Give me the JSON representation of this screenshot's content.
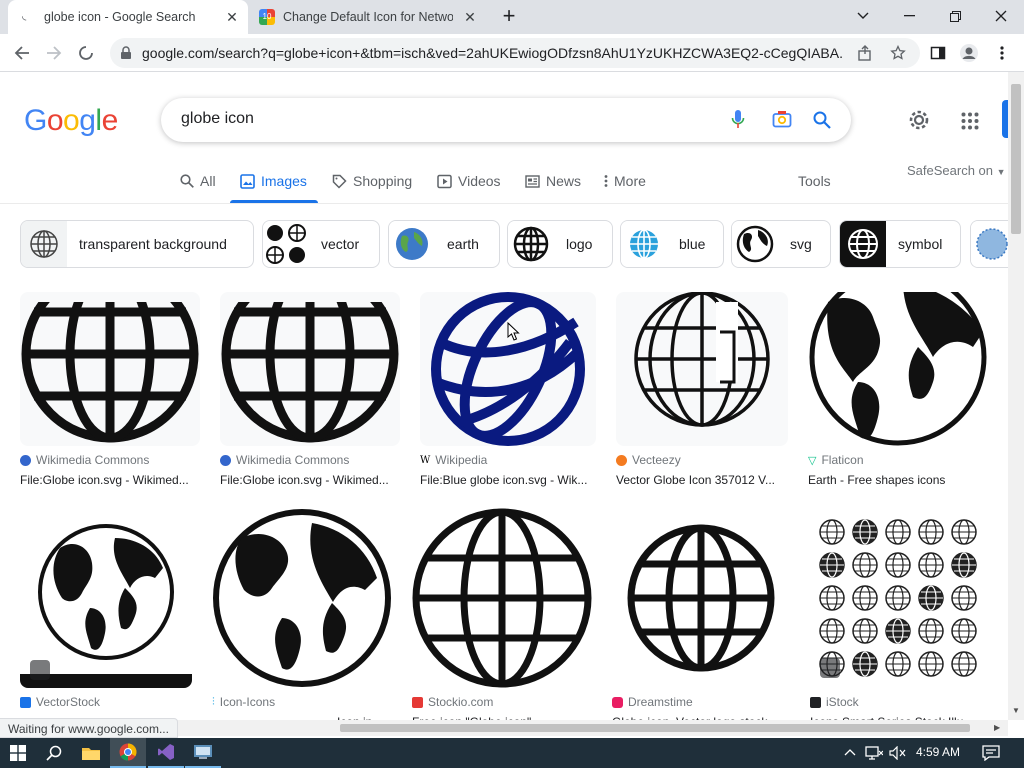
{
  "browser": {
    "tabs": [
      {
        "title": "globe icon - Google Search",
        "active": true
      },
      {
        "title": "Change Default Icon for Network",
        "active": false
      }
    ],
    "url": "google.com/search?q=globe+icon+&tbm=isch&ved=2ahUKEwiogODfzsn8AhU1YzUKHZCWA3EQ2-cCegQIABA...",
    "status_text": "Waiting for www.google.com..."
  },
  "google": {
    "logo_letters": [
      "G",
      "o",
      "o",
      "g",
      "l",
      "e"
    ],
    "logo_colors": [
      "#4285F4",
      "#EA4335",
      "#FBBC05",
      "#4285F4",
      "#34A853",
      "#EA4335"
    ],
    "query": "globe icon",
    "nav_tabs": [
      {
        "label": "All",
        "icon": "search-icon"
      },
      {
        "label": "Images",
        "icon": "image-icon",
        "active": true
      },
      {
        "label": "Shopping",
        "icon": "tag-icon"
      },
      {
        "label": "Videos",
        "icon": "play-icon"
      },
      {
        "label": "News",
        "icon": "news-icon"
      },
      {
        "label": "More",
        "icon": "more-vert-icon"
      }
    ],
    "tools_label": "Tools",
    "safesearch_label": "SafeSearch on"
  },
  "chips": [
    {
      "label": "transparent background"
    },
    {
      "label": "vector"
    },
    {
      "label": "earth"
    },
    {
      "label": "logo"
    },
    {
      "label": "blue"
    },
    {
      "label": "svg"
    },
    {
      "label": "symbol"
    }
  ],
  "results": [
    {
      "source": "Wikimedia Commons",
      "title": "File:Globe icon.svg - Wikimed...",
      "favicon_color": "#3366cc",
      "style": "wire-black"
    },
    {
      "source": "Wikimedia Commons",
      "title": "File:Globe icon.svg - Wikimed...",
      "favicon_color": "#3366cc",
      "style": "wire-black"
    },
    {
      "source": "Wikipedia",
      "title": "File:Blue globe icon.svg - Wik...",
      "favicon_color": "#000000",
      "style": "wire-blue"
    },
    {
      "source": "Vecteezy",
      "title": "Vector Globe Icon 357012 V...",
      "favicon_color": "#f47b20",
      "style": "wire-thin"
    },
    {
      "source": "Flaticon",
      "title": "Earth - Free shapes icons",
      "favicon_color": "#0fc28b",
      "style": "earth"
    },
    {
      "source": "VectorStock",
      "title": "",
      "favicon_color": "#1a73e8",
      "style": "earth-dark"
    },
    {
      "source": "Icon-Icons",
      "title": "",
      "favicon_color": "#2aa7e0",
      "style": "earth"
    },
    {
      "source": "Stockio.com",
      "title": "",
      "favicon_color": "#e53935",
      "style": "wire-black"
    },
    {
      "source": "Dreamstime",
      "title": "",
      "favicon_color": "#e91e63",
      "style": "wire-black"
    },
    {
      "source": "iStock",
      "title": "",
      "favicon_color": "#202124",
      "style": "grid"
    }
  ],
  "result_partial_titles": [
    "Icon in",
    "Free icon \"Globe icon\"",
    "Globe icon. Vector logo stock",
    "Icons Smart Series Stock Illu"
  ],
  "taskbar": {
    "time": "4:59 AM"
  }
}
